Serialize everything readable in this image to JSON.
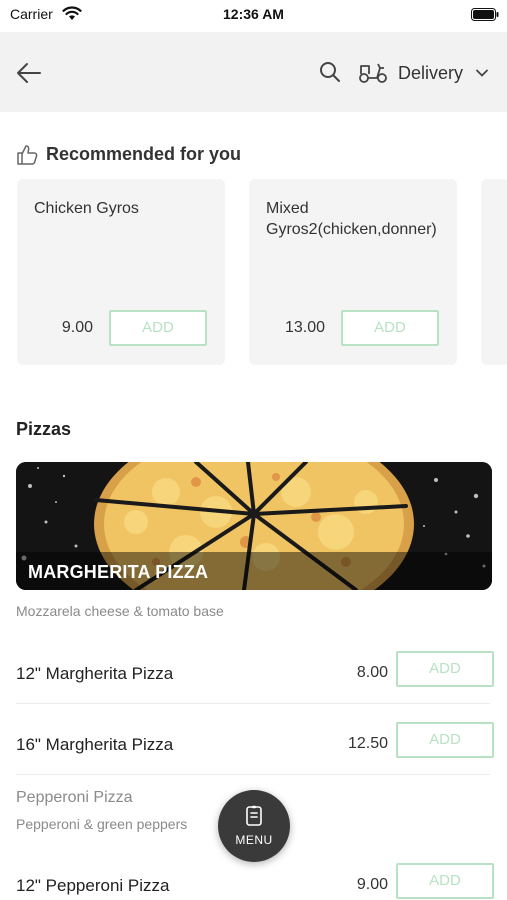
{
  "status_bar": {
    "carrier": "Carrier",
    "time": "12:36 AM"
  },
  "header": {
    "delivery_mode": "Delivery"
  },
  "recommended": {
    "title": "Recommended for you",
    "items": [
      {
        "name": "Chicken Gyros",
        "price": "9.00",
        "add_label": "ADD"
      },
      {
        "name": "Mixed Gyros2(chicken,donner)",
        "price": "13.00",
        "add_label": "ADD"
      }
    ]
  },
  "section": {
    "title": "Pizzas",
    "banner_title": "MARGHERITA PIZZA",
    "description": "Mozzarela cheese & tomato base",
    "items": [
      {
        "name": "12\" Margherita Pizza",
        "price": "8.00",
        "add_label": "ADD"
      },
      {
        "name": "16\" Margherita Pizza",
        "price": "12.50",
        "add_label": "ADD"
      }
    ],
    "subcategory": {
      "name": "Pepperoni Pizza",
      "description": "Pepperoni & green peppers"
    },
    "sub_items": [
      {
        "name": "12\" Pepperoni Pizza",
        "price": "9.00",
        "add_label": "ADD"
      }
    ]
  },
  "fab": {
    "label": "MENU"
  },
  "colors": {
    "header_bg": "#f2f2f2",
    "card_bg": "#f4f4f4",
    "add_border": "#b8e2c3",
    "fab_bg": "#3a3a3a"
  },
  "icons": [
    "wifi-icon",
    "battery-icon",
    "back-arrow-icon",
    "search-icon",
    "scooter-icon",
    "chevron-down-icon",
    "thumbs-up-icon",
    "menu-icon"
  ]
}
